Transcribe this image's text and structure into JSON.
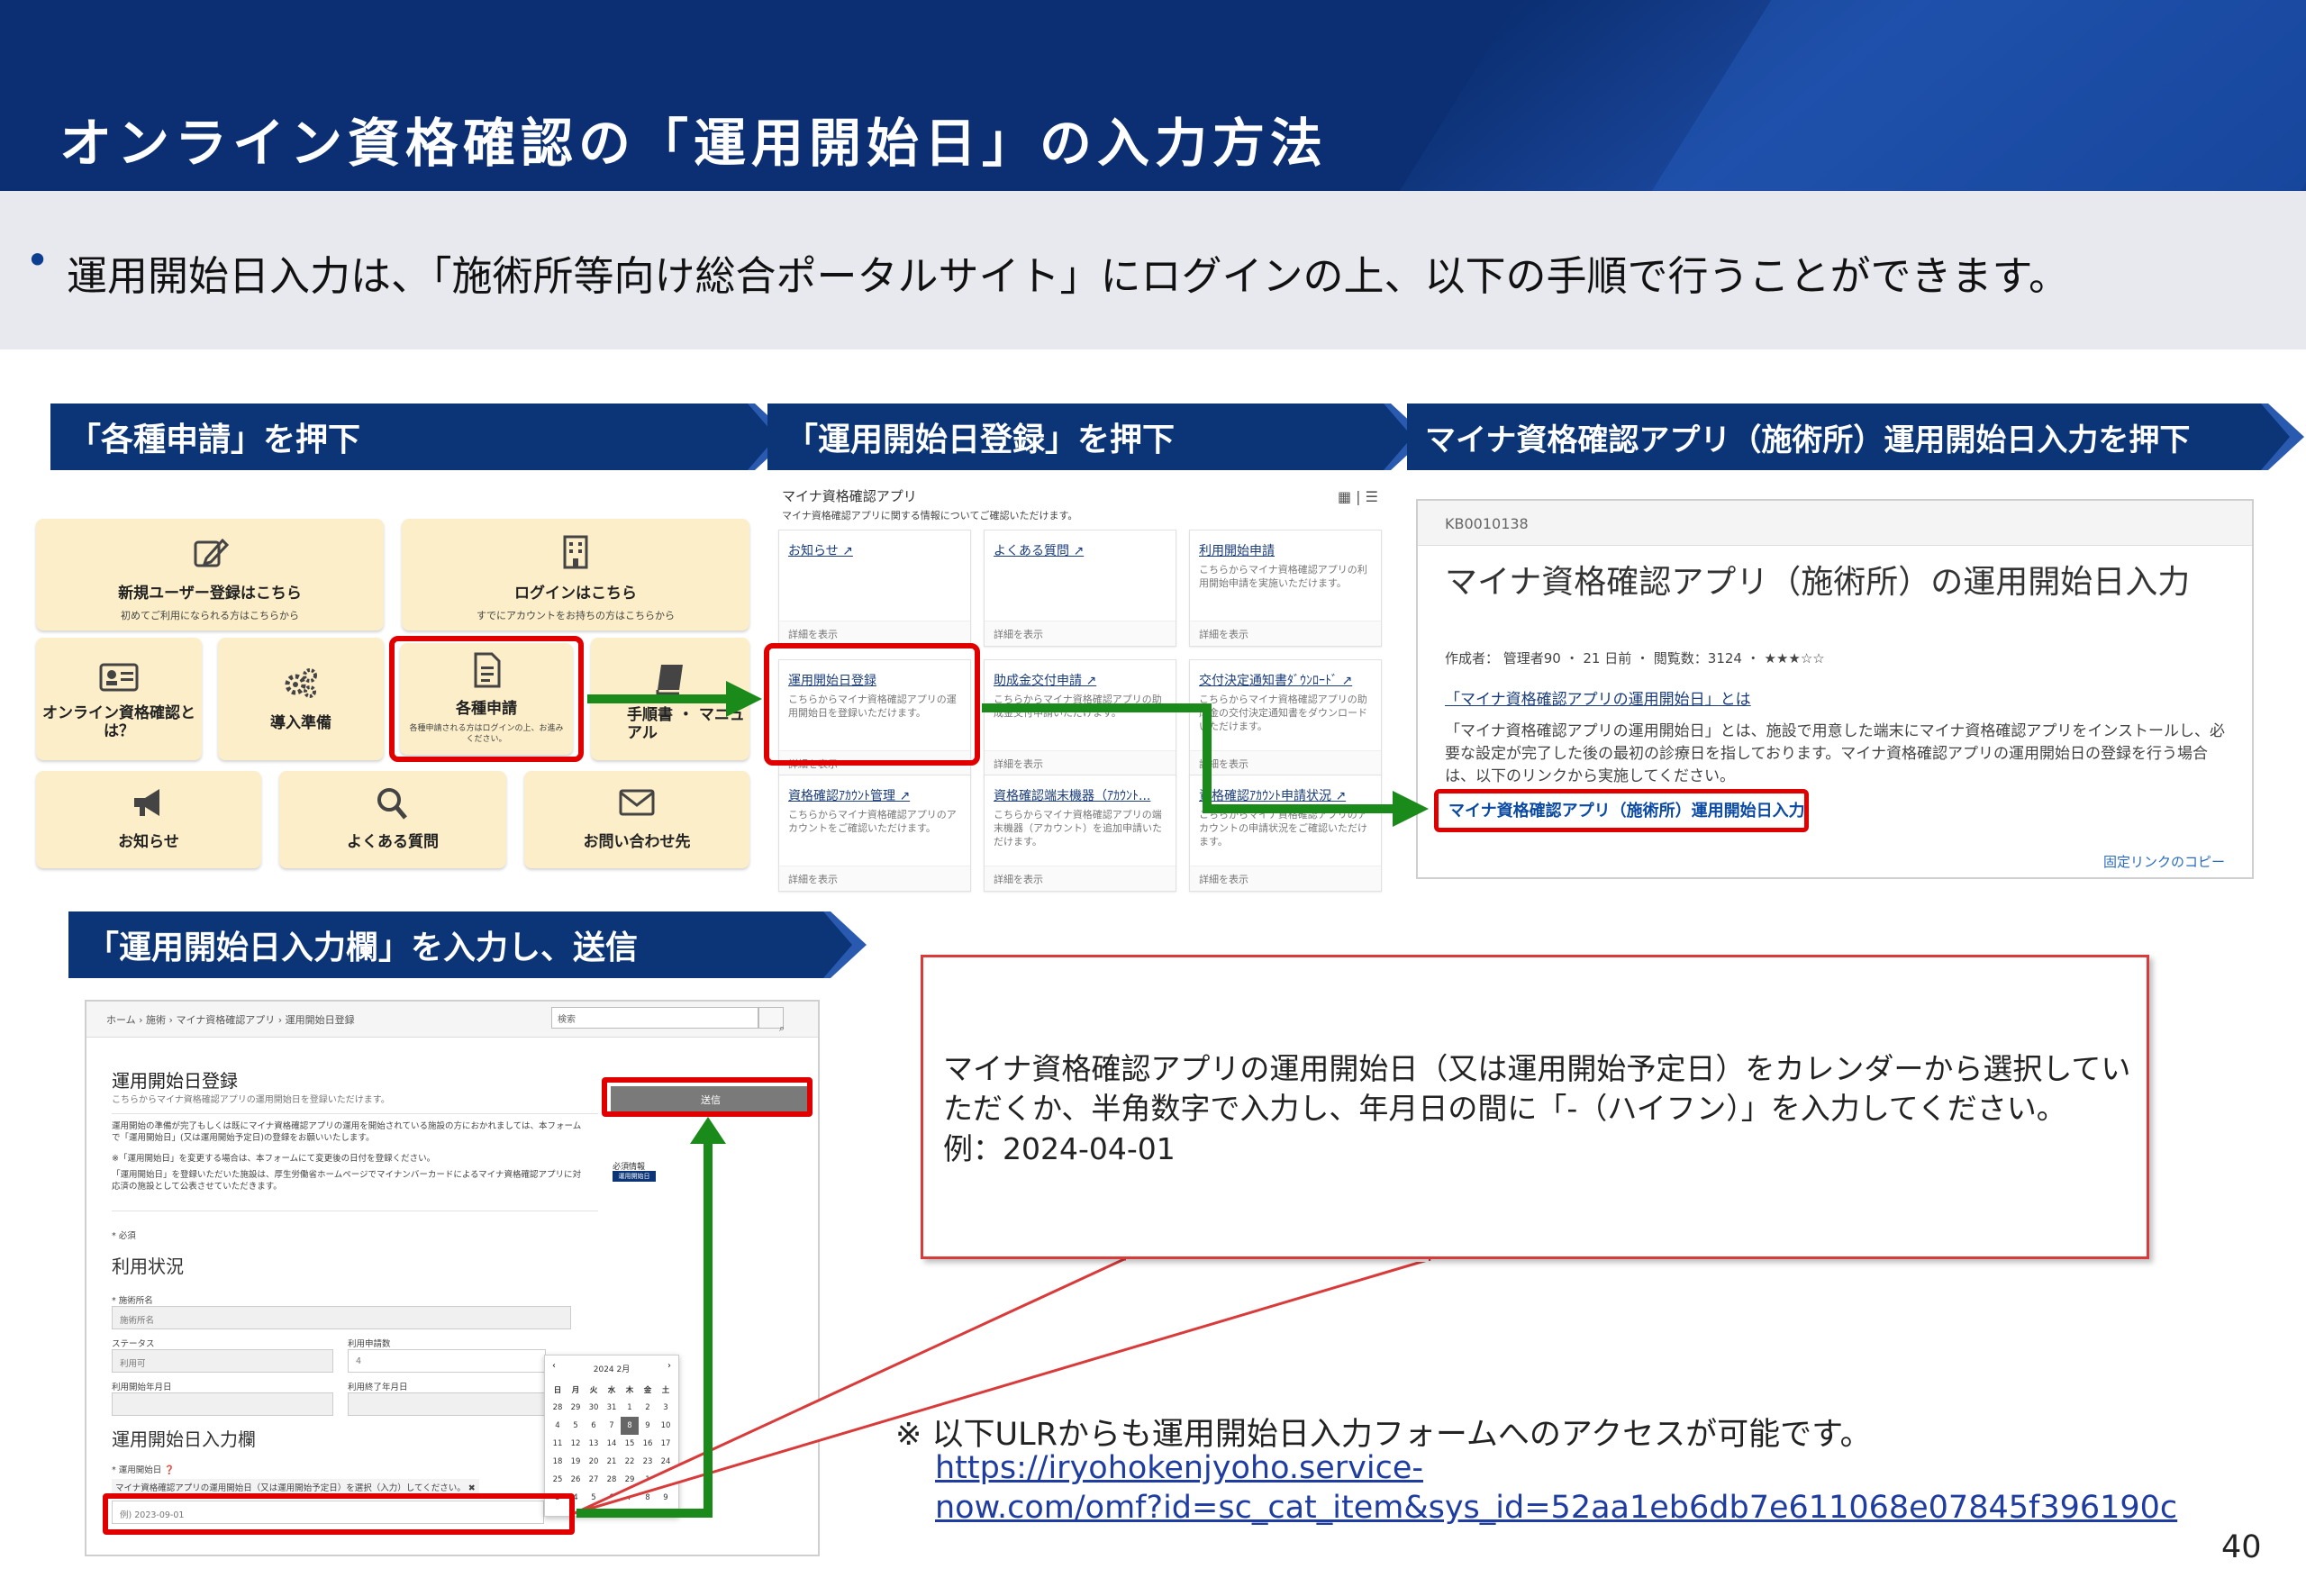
{
  "header": {
    "title": "オンライン資格確認の「運用開始日」の入力方法"
  },
  "intro": {
    "text": "運用開始日入力は、「施術所等向け総合ポータルサイト」にログインの上、以下の手順で行うことができます。"
  },
  "steps": {
    "step1": "「各種申請」を押下",
    "step2": "「運用開始日登録」を押下",
    "step3": "マイナ資格確認アプリ（施術所）運用開始日入力を押下",
    "step4": "「運用開始日入力欄」を入力し、送信"
  },
  "portal": {
    "tiles": [
      {
        "icon": "edit-icon",
        "title": "新規ユーザー登録はこちら",
        "sub": "初めてご利用になられる方はこちらから"
      },
      {
        "icon": "building-icon",
        "title": "ログインはこちら",
        "sub": "すでにアカウントをお持ちの方はこちらから"
      },
      {
        "icon": "id-card-icon",
        "title": "オンライン資格確認とは？",
        "sub": ""
      },
      {
        "icon": "gears-icon",
        "title": "導入準備",
        "sub": ""
      },
      {
        "icon": "document-icon",
        "title": "各種申請",
        "sub": "各種申請される方はログインの上、お進みください。"
      },
      {
        "icon": "book-icon",
        "title": "手順書 ・ マニュアル",
        "sub": ""
      },
      {
        "icon": "megaphone-icon",
        "title": "お知らせ",
        "sub": ""
      },
      {
        "icon": "search-icon",
        "title": "よくある質問",
        "sub": ""
      },
      {
        "icon": "mail-icon",
        "title": "お問い合わせ先",
        "sub": ""
      }
    ]
  },
  "app_grid": {
    "title": "マイナ資格確認アプリ",
    "subtitle": "マイナ資格確認アプリに関する情報についてご確認いただけます。",
    "detail_label": "詳細を表示",
    "cards": [
      {
        "title": "お知らせ ↗",
        "desc": ""
      },
      {
        "title": "よくある質問 ↗",
        "desc": ""
      },
      {
        "title": "利用開始申請",
        "desc": "こちらからマイナ資格確認アプリの利用開始申請を実施いただけます。"
      },
      {
        "title": "運用開始日登録",
        "desc": "こちらからマイナ資格確認アプリの運用開始日を登録いただけます。"
      },
      {
        "title": "助成金交付申請 ↗",
        "desc": "こちらからマイナ資格確認アプリの助成金交付申請いただけます。"
      },
      {
        "title": "交付決定通知書ﾀﾞｳﾝﾛｰﾄﾞ ↗",
        "desc": "こちらからマイナ資格確認アプリの助成金の交付決定通知書をダウンロードいただけます。"
      },
      {
        "title": "資格確認ｱｶｳﾝﾄ管理 ↗",
        "desc": "こちらからマイナ資格確認アプリのアカウントをご確認いただけます。"
      },
      {
        "title": "資格確認端末機器（ｱｶｳﾝﾄ...",
        "desc": "こちらからマイナ資格確認アプリの端末機器（アカウント）を追加申請いただけます。"
      },
      {
        "title": "資格確認ｱｶｳﾝﾄ申請状況 ↗",
        "desc": "こちらからマイナ資格確認アプリのアカウントの申請状況をご確認いただけます。"
      }
    ]
  },
  "kb": {
    "id": "KB0010138",
    "title": "マイナ資格確認アプリ（施術所）の運用開始日入力",
    "meta": "作成者： 管理者90 ・ 21 日前 ・ 閲覧数：3124 ・ ★★★☆☆",
    "heading_link": "「マイナ資格確認アプリの運用開始日」とは",
    "body": "「マイナ資格確認アプリの運用開始日」とは、施設で用意した端末にマイナ資格確認アプリをインストールし、必要な設定が完了した後の最初の診療日を指しております。マイナ資格確認アプリの運用開始日の登録を行う場合は、以下のリンクから実施してください。",
    "action_link": "マイナ資格確認アプリ（施術所）運用開始日入力",
    "copy_link": "固定リンクのコピー"
  },
  "form": {
    "breadcrumb": "ホーム  ›  施術  ›  マイナ資格確認アプリ  ›  運用開始日登録",
    "search_placeholder": "検索",
    "title": "運用開始日登録",
    "subtitle": "こちらからマイナ資格確認アプリの運用開始日を登録いただけます。",
    "para1": "運用開始の準備が完了もしくは既にマイナ資格確認アプリの運用を開始されている施設の方におかれましては、本フォームで「運用開始日」(又は運用開始予定日)の登録をお願いいたします。",
    "para2": "※「運用開始日」を変更する場合は、本フォームにて変更後の日付を登録ください。",
    "para3": "「運用開始日」を登録いただいた施設は、厚生労働省ホームページでマイナンバーカードによるマイナ資格確認アプリに対応済の施設として公表させていただきます。",
    "required": "* 必須",
    "section1": "利用状況",
    "facility_label": "* 施術所名",
    "facility_value": "施術所名",
    "status_label": "ステータス",
    "status_value": "利用可",
    "count_label": "利用申請数",
    "count_value": "4",
    "start_label": "利用開始年月日",
    "end_label": "利用終了年月日",
    "section2": "運用開始日入力欄",
    "date_label": "* 運用開始日",
    "date_hint": "マイナ資格確認アプリの運用開始日（又は運用開始予定日）を選択（入力）してください。",
    "date_placeholder": "例) 2023-09-01",
    "submit": "送信",
    "side_required": "必須情報",
    "side_badge": "運用開始日",
    "calendar": {
      "month": "2024 2月",
      "weekdays": [
        "日",
        "月",
        "火",
        "水",
        "木",
        "金",
        "土"
      ],
      "rows": [
        [
          "28",
          "29",
          "30",
          "31",
          "1",
          "2",
          "3"
        ],
        [
          "4",
          "5",
          "6",
          "7",
          "8",
          "9",
          "10"
        ],
        [
          "11",
          "12",
          "13",
          "14",
          "15",
          "16",
          "17"
        ],
        [
          "18",
          "19",
          "20",
          "21",
          "22",
          "23",
          "24"
        ],
        [
          "25",
          "26",
          "27",
          "28",
          "29",
          "1",
          "2"
        ],
        [
          "3",
          "4",
          "5",
          "6",
          "7",
          "8",
          "9"
        ]
      ]
    }
  },
  "callout": {
    "line1": "マイナ資格確認アプリの運用開始日（又は運用開始予定日）をカレンダーから選択していただくか、半角数字で入力し、年月日の間に「-（ハイフン）」を入力してください。",
    "line2": "例：2024-04-01"
  },
  "note": {
    "text": "※ 以下ULRからも運用開始日入力フォームへのアクセスが可能です。",
    "url_line1": "https://iryohokenjyoho.service-",
    "url_line2": "now.com/omf?id=sc_cat_item&sys_id=52aa1eb6db7e611068e07845f396190c"
  },
  "page_number": "40",
  "colors": {
    "navy": "#0b2f72",
    "ribbon": "#0b3577",
    "tile": "#fbeec8",
    "highlight_red": "#e00000",
    "arrow_green": "#1a8a1a",
    "link_blue": "#1f3da0"
  }
}
